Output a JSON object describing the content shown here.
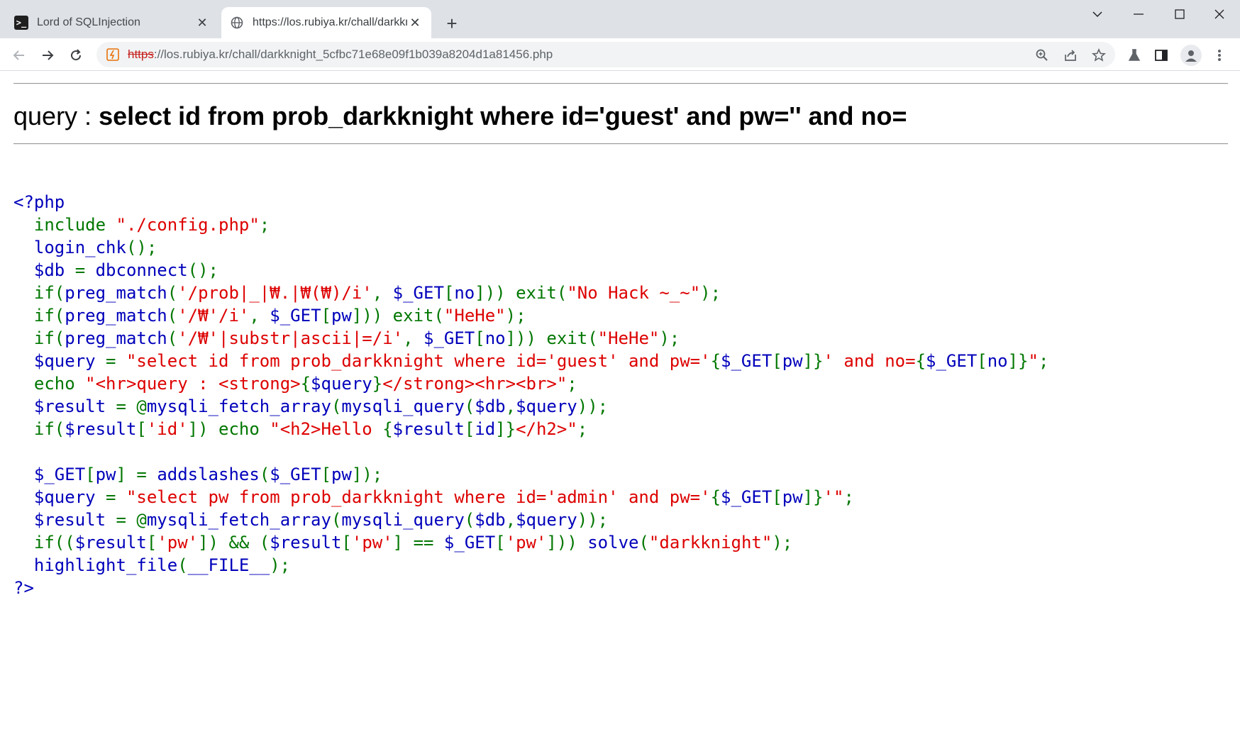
{
  "browser": {
    "tabs": [
      {
        "title": "Lord of SQLInjection",
        "favicon": "terminal-icon",
        "active": false
      },
      {
        "title": "https://los.rubiya.kr/chall/darkkn",
        "favicon": "globe-icon",
        "active": true
      }
    ],
    "new_tab_label": "+",
    "window_controls": {
      "chevron": "⌄",
      "minimize": "—",
      "maximize": "☐",
      "close": "✕"
    },
    "url_scheme": "https",
    "url_rest": "://los.rubiya.kr/chall/darkknight_5cfbc71e68e09f1b039a8204d1a81456.php"
  },
  "page": {
    "query_prefix": "query : ",
    "query_sql": "select id from prob_darkknight where id='guest' and pw='' and no=",
    "source_lines": [
      [
        [
          "df",
          "<?php"
        ]
      ],
      [
        [
          "kw",
          "  include "
        ],
        [
          "st",
          "\"./config.php\""
        ],
        [
          "kw",
          ";"
        ]
      ],
      [
        [
          "df",
          "  login_chk"
        ],
        [
          "kw",
          "();"
        ]
      ],
      [
        [
          "df",
          "  $db "
        ],
        [
          "kw",
          "= "
        ],
        [
          "df",
          "dbconnect"
        ],
        [
          "kw",
          "();"
        ]
      ],
      [
        [
          "kw",
          "  if("
        ],
        [
          "df",
          "preg_match"
        ],
        [
          "kw",
          "("
        ],
        [
          "st",
          "'/prob|_|₩.|₩(₩)/i'"
        ],
        [
          "kw",
          ", "
        ],
        [
          "df",
          "$_GET"
        ],
        [
          "kw",
          "["
        ],
        [
          "df",
          "no"
        ],
        [
          "kw",
          "])) exit("
        ],
        [
          "st",
          "\"No Hack ~_~\""
        ],
        [
          "kw",
          ");"
        ]
      ],
      [
        [
          "kw",
          "  if("
        ],
        [
          "df",
          "preg_match"
        ],
        [
          "kw",
          "("
        ],
        [
          "st",
          "'/₩'/i'"
        ],
        [
          "kw",
          ", "
        ],
        [
          "df",
          "$_GET"
        ],
        [
          "kw",
          "["
        ],
        [
          "df",
          "pw"
        ],
        [
          "kw",
          "])) exit("
        ],
        [
          "st",
          "\"HeHe\""
        ],
        [
          "kw",
          ");"
        ]
      ],
      [
        [
          "kw",
          "  if("
        ],
        [
          "df",
          "preg_match"
        ],
        [
          "kw",
          "("
        ],
        [
          "st",
          "'/₩'|substr|ascii|=/i'"
        ],
        [
          "kw",
          ", "
        ],
        [
          "df",
          "$_GET"
        ],
        [
          "kw",
          "["
        ],
        [
          "df",
          "no"
        ],
        [
          "kw",
          "])) exit("
        ],
        [
          "st",
          "\"HeHe\""
        ],
        [
          "kw",
          ");"
        ]
      ],
      [
        [
          "df",
          "  $query "
        ],
        [
          "kw",
          "= "
        ],
        [
          "st",
          "\"select id from prob_darkknight where id='guest' and pw='"
        ],
        [
          "kw",
          "{"
        ],
        [
          "df",
          "$_GET"
        ],
        [
          "kw",
          "["
        ],
        [
          "df",
          "pw"
        ],
        [
          "kw",
          "]}"
        ],
        [
          "st",
          "' and no="
        ],
        [
          "kw",
          "{"
        ],
        [
          "df",
          "$_GET"
        ],
        [
          "kw",
          "["
        ],
        [
          "df",
          "no"
        ],
        [
          "kw",
          "]}"
        ],
        [
          "st",
          "\""
        ],
        [
          "kw",
          ";"
        ]
      ],
      [
        [
          "kw",
          "  echo "
        ],
        [
          "st",
          "\"<hr>query : <strong>"
        ],
        [
          "kw",
          "{"
        ],
        [
          "df",
          "$query"
        ],
        [
          "kw",
          "}"
        ],
        [
          "st",
          "</strong><hr><br>\""
        ],
        [
          "kw",
          ";"
        ]
      ],
      [
        [
          "df",
          "  $result "
        ],
        [
          "kw",
          "= @"
        ],
        [
          "df",
          "mysqli_fetch_array"
        ],
        [
          "kw",
          "("
        ],
        [
          "df",
          "mysqli_query"
        ],
        [
          "kw",
          "("
        ],
        [
          "df",
          "$db"
        ],
        [
          "kw",
          ","
        ],
        [
          "df",
          "$query"
        ],
        [
          "kw",
          "));"
        ]
      ],
      [
        [
          "kw",
          "  if("
        ],
        [
          "df",
          "$result"
        ],
        [
          "kw",
          "["
        ],
        [
          "st",
          "'id'"
        ],
        [
          "kw",
          "]) echo "
        ],
        [
          "st",
          "\"<h2>Hello "
        ],
        [
          "kw",
          "{"
        ],
        [
          "df",
          "$result"
        ],
        [
          "kw",
          "["
        ],
        [
          "df",
          "id"
        ],
        [
          "kw",
          "]}"
        ],
        [
          "st",
          "</h2>\""
        ],
        [
          "kw",
          ";"
        ]
      ],
      [
        [
          "df",
          " "
        ]
      ],
      [
        [
          "df",
          "  $_GET"
        ],
        [
          "kw",
          "["
        ],
        [
          "df",
          "pw"
        ],
        [
          "kw",
          "] = "
        ],
        [
          "df",
          "addslashes"
        ],
        [
          "kw",
          "("
        ],
        [
          "df",
          "$_GET"
        ],
        [
          "kw",
          "["
        ],
        [
          "df",
          "pw"
        ],
        [
          "kw",
          "]);"
        ]
      ],
      [
        [
          "df",
          "  $query "
        ],
        [
          "kw",
          "= "
        ],
        [
          "st",
          "\"select pw from prob_darkknight where id='admin' and pw='"
        ],
        [
          "kw",
          "{"
        ],
        [
          "df",
          "$_GET"
        ],
        [
          "kw",
          "["
        ],
        [
          "df",
          "pw"
        ],
        [
          "kw",
          "]}"
        ],
        [
          "st",
          "'\""
        ],
        [
          "kw",
          ";"
        ]
      ],
      [
        [
          "df",
          "  $result "
        ],
        [
          "kw",
          "= @"
        ],
        [
          "df",
          "mysqli_fetch_array"
        ],
        [
          "kw",
          "("
        ],
        [
          "df",
          "mysqli_query"
        ],
        [
          "kw",
          "("
        ],
        [
          "df",
          "$db"
        ],
        [
          "kw",
          ","
        ],
        [
          "df",
          "$query"
        ],
        [
          "kw",
          "));"
        ]
      ],
      [
        [
          "kw",
          "  if(("
        ],
        [
          "df",
          "$result"
        ],
        [
          "kw",
          "["
        ],
        [
          "st",
          "'pw'"
        ],
        [
          "kw",
          "]) && ("
        ],
        [
          "df",
          "$result"
        ],
        [
          "kw",
          "["
        ],
        [
          "st",
          "'pw'"
        ],
        [
          "kw",
          "] == "
        ],
        [
          "df",
          "$_GET"
        ],
        [
          "kw",
          "["
        ],
        [
          "st",
          "'pw'"
        ],
        [
          "kw",
          "])) "
        ],
        [
          "df",
          "solve"
        ],
        [
          "kw",
          "("
        ],
        [
          "st",
          "\"darkknight\""
        ],
        [
          "kw",
          ");"
        ]
      ],
      [
        [
          "df",
          "  highlight_file"
        ],
        [
          "kw",
          "("
        ],
        [
          "df",
          "__FILE__"
        ],
        [
          "kw",
          ");"
        ]
      ],
      [
        [
          "df",
          "?>"
        ]
      ]
    ]
  },
  "colors": {
    "keyword": "#007700",
    "default": "#0000bb",
    "string": "#dd0000",
    "chrome_bg": "#dee1e6",
    "omnibox_bg": "#f1f3f4",
    "insecure": "#c5221f"
  }
}
